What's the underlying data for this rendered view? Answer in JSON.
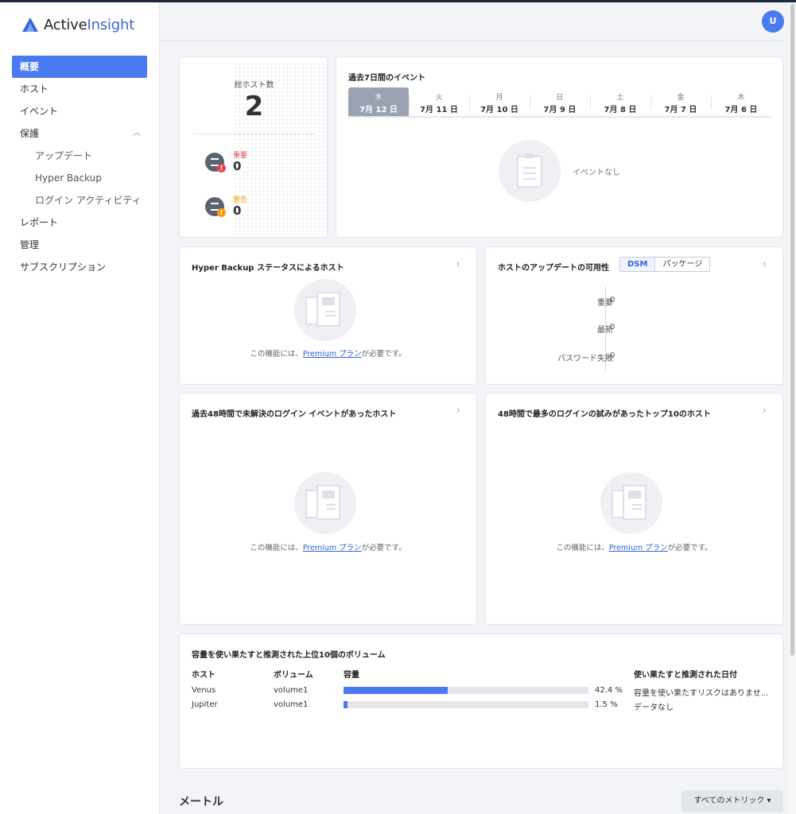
{
  "app": {
    "logo_prefix": "Active",
    "logo_accent": "Insight",
    "avatar": "U"
  },
  "nav": {
    "overview": "概要",
    "hosts": "ホスト",
    "events": "イベント",
    "protection": "保護",
    "updates": "アップデート",
    "hyper_backup": "Hyper Backup",
    "login_activity": "ログイン アクティビティ",
    "reports": "レポート",
    "manage": "管理",
    "subscription": "サブスクリプション"
  },
  "total": {
    "label": "総ホスト数",
    "value": "2",
    "critical_label": "重要",
    "critical_value": "0",
    "warning_label": "警告",
    "warning_value": "0",
    "critical_color": "#e5484d",
    "warning_color": "#f59e0b"
  },
  "events": {
    "title": "過去7日間のイベント",
    "empty": "イベントなし",
    "days": [
      {
        "dow": "水",
        "date": "7月 12 日"
      },
      {
        "dow": "火",
        "date": "7月 11 日"
      },
      {
        "dow": "月",
        "date": "7月 10 日"
      },
      {
        "dow": "日",
        "date": "7月 9 日"
      },
      {
        "dow": "土",
        "date": "7月 8 日"
      },
      {
        "dow": "金",
        "date": "7月 7 日"
      },
      {
        "dow": "木",
        "date": "7月 6 日"
      }
    ]
  },
  "premium": {
    "prefix": "この機能には、",
    "link": "Premium プラン",
    "suffix": "が必要です。"
  },
  "hb": {
    "title": "Hyper Backup ステータスによるホスト"
  },
  "updates": {
    "title": "ホストのアップデートの可用性",
    "tab_dsm": "DSM",
    "tab_pkg": "パッケージ",
    "rows": [
      {
        "label": "重要",
        "value": "0"
      },
      {
        "label": "最新",
        "value": "0"
      },
      {
        "label": "パスワード失敗",
        "value": "0"
      }
    ]
  },
  "login48": {
    "title": "過去48時間で未解決のログイン イベントがあったホスト"
  },
  "top10": {
    "title": "48時間で最多のログインの試みがあったトップ10のホスト"
  },
  "volumes": {
    "title": "容量を使い果たすと推測された上位10個のボリューム",
    "headers": {
      "host": "ホスト",
      "volume": "ボリューム",
      "capacity": "容量",
      "date": "使い果たすと推測された日付"
    },
    "rows": [
      {
        "host": "Venus",
        "volume": "volume1",
        "pct": 42.4,
        "pct_label": "42.4 %",
        "date": "容量を使い果たすリスクはありませ..."
      },
      {
        "host": "Jupiter",
        "volume": "volume1",
        "pct": 1.5,
        "pct_label": "1.5 %",
        "date": "データなし"
      }
    ]
  },
  "metrics": {
    "title": "メートル",
    "button": "すべてのメトリック ▾"
  }
}
